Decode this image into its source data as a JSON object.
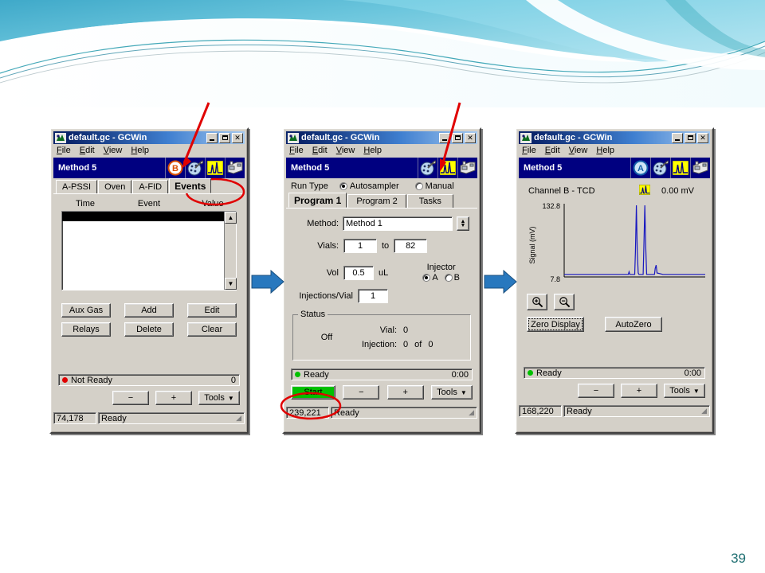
{
  "slide": {
    "page_number": "39"
  },
  "arrows": [
    {
      "name": "flow-arrow-1"
    },
    {
      "name": "flow-arrow-2"
    }
  ],
  "windows": [
    {
      "id": "win-events",
      "title": "default.gc - GCWin",
      "title_icon": "gcwin-app-icon",
      "buttons": {
        "minimize": "_",
        "maximize": "❐",
        "close": "✕"
      },
      "menu": [
        "File",
        "Edit",
        "View",
        "Help"
      ],
      "method_bar": {
        "label": "Method 5",
        "icons": [
          "detector-b-icon",
          "palette-dial-icon",
          "chromatogram-icon",
          "gc-instrument-icon"
        ]
      },
      "tabs": [
        {
          "label": "A-PSSI",
          "selected": false
        },
        {
          "label": "Oven",
          "selected": false
        },
        {
          "label": "A-FID",
          "selected": false
        },
        {
          "label": "Events",
          "selected": true
        }
      ],
      "table": {
        "headers": [
          "Time",
          "Event",
          "Value"
        ],
        "rows": []
      },
      "action_buttons": [
        [
          "Aux Gas",
          "Add",
          "Edit"
        ],
        [
          "Relays",
          "Delete",
          "Clear"
        ]
      ],
      "status": {
        "led": "red",
        "text": "Not Ready",
        "right": "0"
      },
      "controls": {
        "minus": "−",
        "plus": "+",
        "tools": "Tools"
      },
      "statusbar": {
        "coords": "74,178",
        "message": "Ready"
      }
    },
    {
      "id": "win-autosampler",
      "title": "default.gc - GCWin",
      "title_icon": "gcwin-app-icon",
      "buttons": {
        "minimize": "_",
        "maximize": "❐",
        "close": "✕"
      },
      "menu": [
        "File",
        "Edit",
        "View",
        "Help"
      ],
      "method_bar": {
        "label": "Method 5",
        "icons": [
          "palette-dial-icon",
          "chromatogram-icon",
          "gc-instrument-icon"
        ]
      },
      "run_type": {
        "label": "Run Type",
        "options": [
          "Autosampler",
          "Manual"
        ],
        "selected": "Autosampler"
      },
      "tabs": [
        {
          "label": "Program 1",
          "selected": true
        },
        {
          "label": "Program 2",
          "selected": false
        },
        {
          "label": "Tasks",
          "selected": false
        }
      ],
      "form": {
        "method_label": "Method:",
        "method_value": "Method 1",
        "vials_label": "Vials:",
        "vials_from": "1",
        "vials_to_label": "to",
        "vials_to": "82",
        "vol_label": "Vol",
        "vol_value": "0.5",
        "vol_units": "uL",
        "injections_label": "Injections/Vial",
        "injections_value": "1",
        "injector_label": "Injector",
        "injector_options": [
          "A",
          "B"
        ],
        "injector_selected": "A"
      },
      "status_group": {
        "title": "Status",
        "state": "Off",
        "vial_label": "Vial:",
        "vial_value": "0",
        "injection_label": "Injection:",
        "injection_value": "0",
        "of_label": "of",
        "injection_total": "0"
      },
      "status": {
        "led": "green",
        "text": "Ready",
        "right": "0:00"
      },
      "controls": {
        "start": "Start",
        "minus": "−",
        "plus": "+",
        "tools": "Tools"
      },
      "statusbar": {
        "coords": "239,221",
        "message": "Ready"
      }
    },
    {
      "id": "win-chromatogram",
      "title": "default.gc - GCWin",
      "title_icon": "gcwin-app-icon",
      "buttons": {
        "minimize": "_",
        "maximize": "❐",
        "close": "✕"
      },
      "menu": [
        "File",
        "Edit",
        "View",
        "Help"
      ],
      "method_bar": {
        "label": "Method 5",
        "icons": [
          "autosampler-a-icon",
          "palette-dial-icon",
          "chromatogram-icon",
          "gc-instrument-icon"
        ]
      },
      "channel": {
        "name": "Channel B - TCD",
        "icon": "chromatogram-small-icon",
        "signal": "0.00 mV"
      },
      "zoom_buttons": [
        "zoom-in-icon",
        "zoom-out-icon"
      ],
      "plot_buttons": [
        "Zero Display",
        "AutoZero"
      ],
      "status": {
        "led": "green",
        "text": "Ready",
        "right": "0:00"
      },
      "controls": {
        "minus": "−",
        "plus": "+",
        "tools": "Tools"
      },
      "statusbar": {
        "coords": "168,220",
        "message": "Ready"
      }
    }
  ],
  "chart_data": {
    "type": "line",
    "title": "Channel B - TCD",
    "xlabel": "",
    "ylabel": "Signal (mV)",
    "ylim": [
      7.8,
      132.8
    ],
    "ytick_labels": [
      "132.8",
      "7.8"
    ],
    "grid": false,
    "legend": "none",
    "series": [
      {
        "name": "Channel B - TCD",
        "color": "#1818c0",
        "x": [
          0,
          0.4,
          0.455,
          0.46,
          0.465,
          0.5,
          0.505,
          0.512,
          0.518,
          0.525,
          0.53,
          0.56,
          0.565,
          0.572,
          0.578,
          0.585,
          0.63,
          0.64,
          0.645,
          0.652,
          0.658,
          0.7,
          1.0
        ],
        "y": [
          9.5,
          9.5,
          9.5,
          14.0,
          9.5,
          9.5,
          50.0,
          132.8,
          50.0,
          12.0,
          9.5,
          9.5,
          60.0,
          132.8,
          60.0,
          9.5,
          9.5,
          9.5,
          20.0,
          26.0,
          12.0,
          9.5,
          9.5
        ]
      }
    ],
    "annotations": [
      "0.00 mV"
    ]
  }
}
